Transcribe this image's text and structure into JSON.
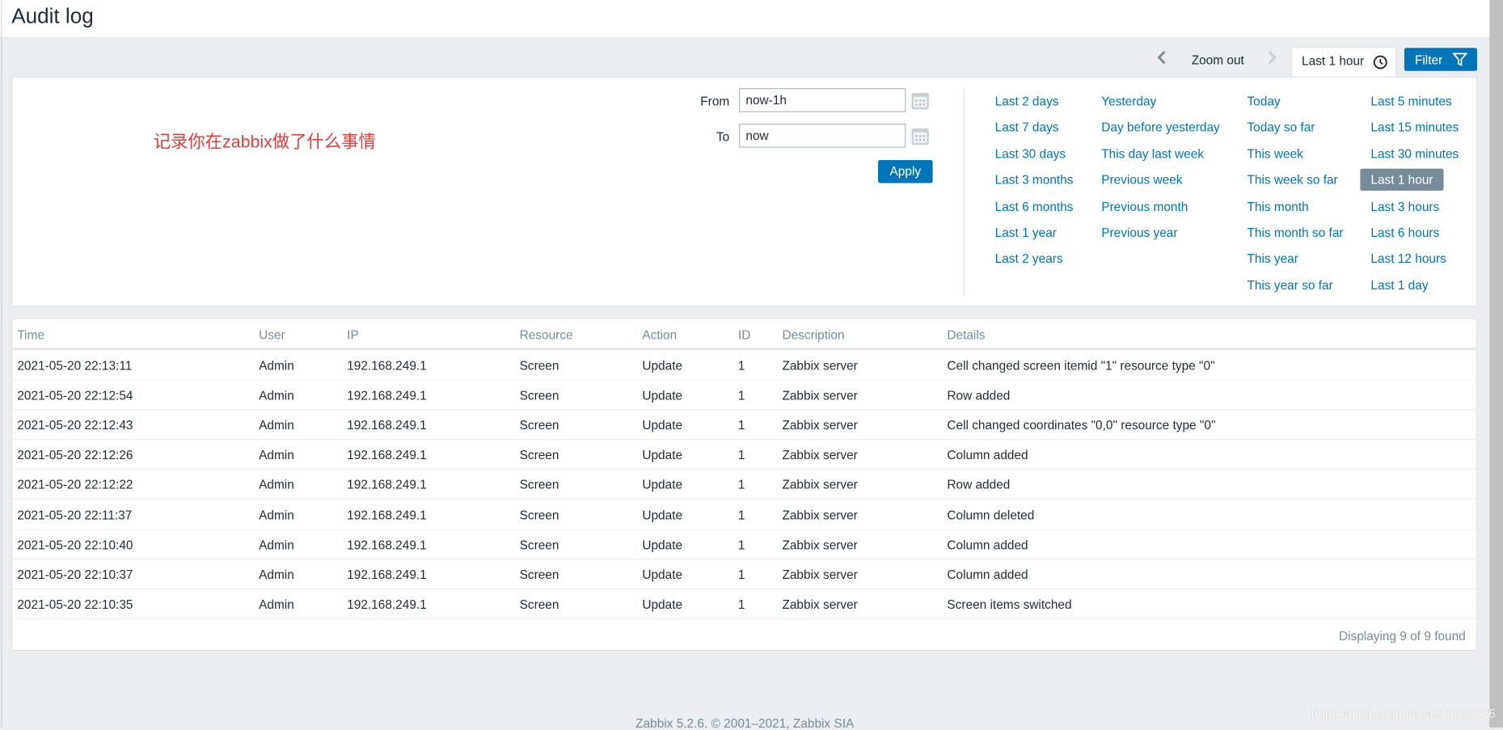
{
  "header": {
    "title": "Audit log"
  },
  "timebar": {
    "prev_icon": "chevron-left-icon",
    "zoom_out": "Zoom out",
    "next_icon": "chevron-right-icon",
    "tab_label": "Last 1 hour",
    "tab_icon": "clock-icon",
    "filter_label": "Filter",
    "filter_icon": "funnel-icon"
  },
  "annotation": "记录你在zabbix做了什么事情",
  "filter": {
    "from_label": "From",
    "from_value": "now-1h",
    "to_label": "To",
    "to_value": "now",
    "apply_label": "Apply",
    "calendar_icon": "calendar-icon"
  },
  "quick_ranges": [
    [
      "Last 2 days",
      "Last 7 days",
      "Last 30 days",
      "Last 3 months",
      "Last 6 months",
      "Last 1 year",
      "Last 2 years"
    ],
    [
      "Yesterday",
      "Day before yesterday",
      "This day last week",
      "Previous week",
      "Previous month",
      "Previous year"
    ],
    [
      "Today",
      "Today so far",
      "This week",
      "This week so far",
      "This month",
      "This month so far",
      "This year",
      "This year so far"
    ],
    [
      "Last 5 minutes",
      "Last 15 minutes",
      "Last 30 minutes",
      "Last 1 hour",
      "Last 3 hours",
      "Last 6 hours",
      "Last 12 hours",
      "Last 1 day"
    ]
  ],
  "selected_range": "Last 1 hour",
  "table": {
    "columns": [
      "Time",
      "User",
      "IP",
      "Resource",
      "Action",
      "ID",
      "Description",
      "Details"
    ],
    "rows": [
      [
        "2021-05-20 22:13:11",
        "Admin",
        "192.168.249.1",
        "Screen",
        "Update",
        "1",
        "Zabbix server",
        "Cell changed screen itemid \"1\" resource type \"0\""
      ],
      [
        "2021-05-20 22:12:54",
        "Admin",
        "192.168.249.1",
        "Screen",
        "Update",
        "1",
        "Zabbix server",
        "Row added"
      ],
      [
        "2021-05-20 22:12:43",
        "Admin",
        "192.168.249.1",
        "Screen",
        "Update",
        "1",
        "Zabbix server",
        "Cell changed coordinates \"0,0\" resource type \"0\""
      ],
      [
        "2021-05-20 22:12:26",
        "Admin",
        "192.168.249.1",
        "Screen",
        "Update",
        "1",
        "Zabbix server",
        "Column added"
      ],
      [
        "2021-05-20 22:12:22",
        "Admin",
        "192.168.249.1",
        "Screen",
        "Update",
        "1",
        "Zabbix server",
        "Row added"
      ],
      [
        "2021-05-20 22:11:37",
        "Admin",
        "192.168.249.1",
        "Screen",
        "Update",
        "1",
        "Zabbix server",
        "Column deleted"
      ],
      [
        "2021-05-20 22:10:40",
        "Admin",
        "192.168.249.1",
        "Screen",
        "Update",
        "1",
        "Zabbix server",
        "Column added"
      ],
      [
        "2021-05-20 22:10:37",
        "Admin",
        "192.168.249.1",
        "Screen",
        "Update",
        "1",
        "Zabbix server",
        "Column added"
      ],
      [
        "2021-05-20 22:10:35",
        "Admin",
        "192.168.249.1",
        "Screen",
        "Update",
        "1",
        "Zabbix server",
        "Screen items switched"
      ]
    ],
    "count": "Displaying 9 of 9 found"
  },
  "footer": "Zabbix 5.2.6. © 2001–2021, Zabbix SIA",
  "watermark": "https://blog.csdn.net/a913909626",
  "colors": {
    "accent": "#0275b8",
    "background": "#ebeef0",
    "muted": "#768d99",
    "annotation": "#f03a3a"
  }
}
